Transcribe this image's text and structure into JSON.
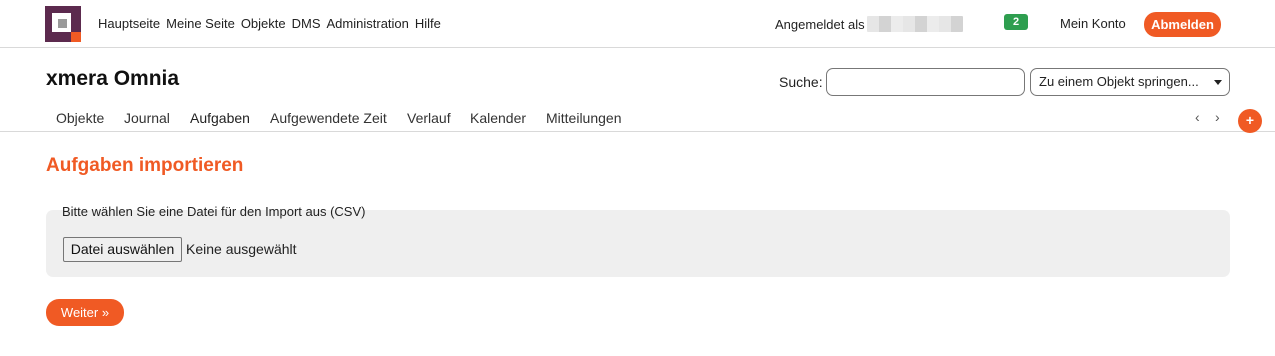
{
  "topbar": {
    "menu": [
      {
        "label": "Hauptseite"
      },
      {
        "label": "Meine Seite"
      },
      {
        "label": "Objekte"
      },
      {
        "label": "DMS"
      },
      {
        "label": "Administration"
      },
      {
        "label": "Hilfe"
      }
    ],
    "logged_in_as": "Angemeldet als",
    "notification_count": "2",
    "my_account": "Mein Konto",
    "logout": "Abmelden"
  },
  "header": {
    "project_title": "xmera Omnia",
    "search_label": "Suche:",
    "search_value": "",
    "jump_label": "Zu einem Objekt springen..."
  },
  "tabs": [
    {
      "label": "Objekte"
    },
    {
      "label": "Journal"
    },
    {
      "label": "Aufgaben",
      "active": true
    },
    {
      "label": "Aufgewendete Zeit"
    },
    {
      "label": "Verlauf"
    },
    {
      "label": "Kalender"
    },
    {
      "label": "Mitteilungen"
    }
  ],
  "tabnav": {
    "prev": "‹",
    "next": "›",
    "add": "+"
  },
  "content": {
    "heading": "Aufgaben importieren",
    "fieldset_legend": "Bitte wählen Sie eine Datei für den Import aus (CSV)",
    "file_button": "Datei auswählen",
    "file_status": "Keine ausgewählt",
    "next_button": "Weiter »"
  },
  "colors": {
    "accent": "#f05a24",
    "brand": "#5c2a4e",
    "badge": "#2e9e4f"
  }
}
